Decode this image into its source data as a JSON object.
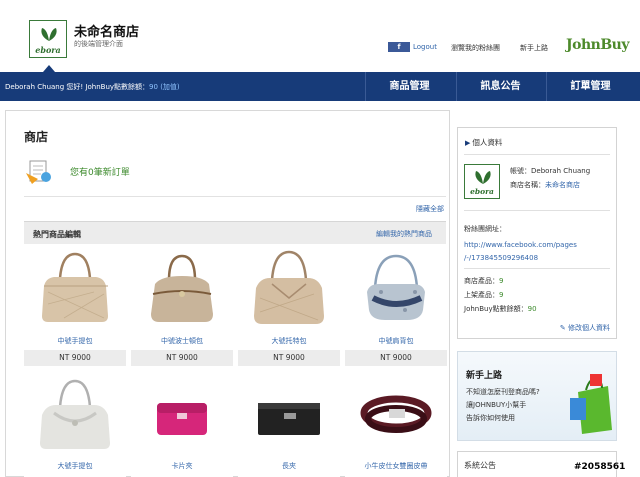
{
  "header": {
    "logo_text": "ebora",
    "shop_name": "未命名商店",
    "subtitle": "的後端管理介面",
    "fb_label": "f",
    "logout": "Logout",
    "link_view_fans": "瀏覽我的粉絲團",
    "link_newbie": "新手上路",
    "brand": "JohnBuy"
  },
  "navbar": {
    "greeting": "Deborah Chuang 您好! JohnBuy點數餘額：",
    "points": "90",
    "add_points": "(加值)",
    "tabs": [
      "商品管理",
      "訊息公告",
      "訂單管理"
    ]
  },
  "main": {
    "title": "商店",
    "order_notice": "您有0筆新訂單",
    "hide_all": "隱藏全部",
    "section_label": "熱門商品編輯",
    "section_edit": "編輯我的熱門商品",
    "products": [
      {
        "name": "中號手提包",
        "price": "NT 9000"
      },
      {
        "name": "中號波士頓包",
        "price": "NT 9000"
      },
      {
        "name": "大號托特包",
        "price": "NT 9000"
      },
      {
        "name": "中號肩背包",
        "price": "NT 9000"
      },
      {
        "name": "大號手提包",
        "price": ""
      },
      {
        "name": "卡片夾",
        "price": ""
      },
      {
        "name": "長夾",
        "price": ""
      },
      {
        "name": "小牛皮仕女雙圈皮帶",
        "price": ""
      }
    ]
  },
  "profile": {
    "heading": "個人資料",
    "account_label": "帳號：",
    "account_value": "Deborah Chuang",
    "shop_label": "商店名稱：",
    "shop_value": "未命名商店",
    "fans_label": "粉絲團網址：",
    "fans_url_1": "http://www.facebook.com/pages",
    "fans_url_2": "/-/173845509296408",
    "stat_products_label": "商店產品：",
    "stat_products": "9",
    "stat_listed_label": "上架產品：",
    "stat_listed": "9",
    "stat_points_label": "JohnBuy點數餘額：",
    "stat_points": "90",
    "edit": "修改個人資料"
  },
  "newbie": {
    "title": "新手上路",
    "line1": "不知道怎麼刊登商品嗎?",
    "line2": "讓JOHNBUY小幫手",
    "line3": "告訴你如何使用"
  },
  "sysnews": {
    "title": "系統公告"
  },
  "watermark": "#2058561",
  "colors": {
    "nav": "#173b79",
    "link": "#3366aa",
    "green": "#3c8a2c"
  }
}
